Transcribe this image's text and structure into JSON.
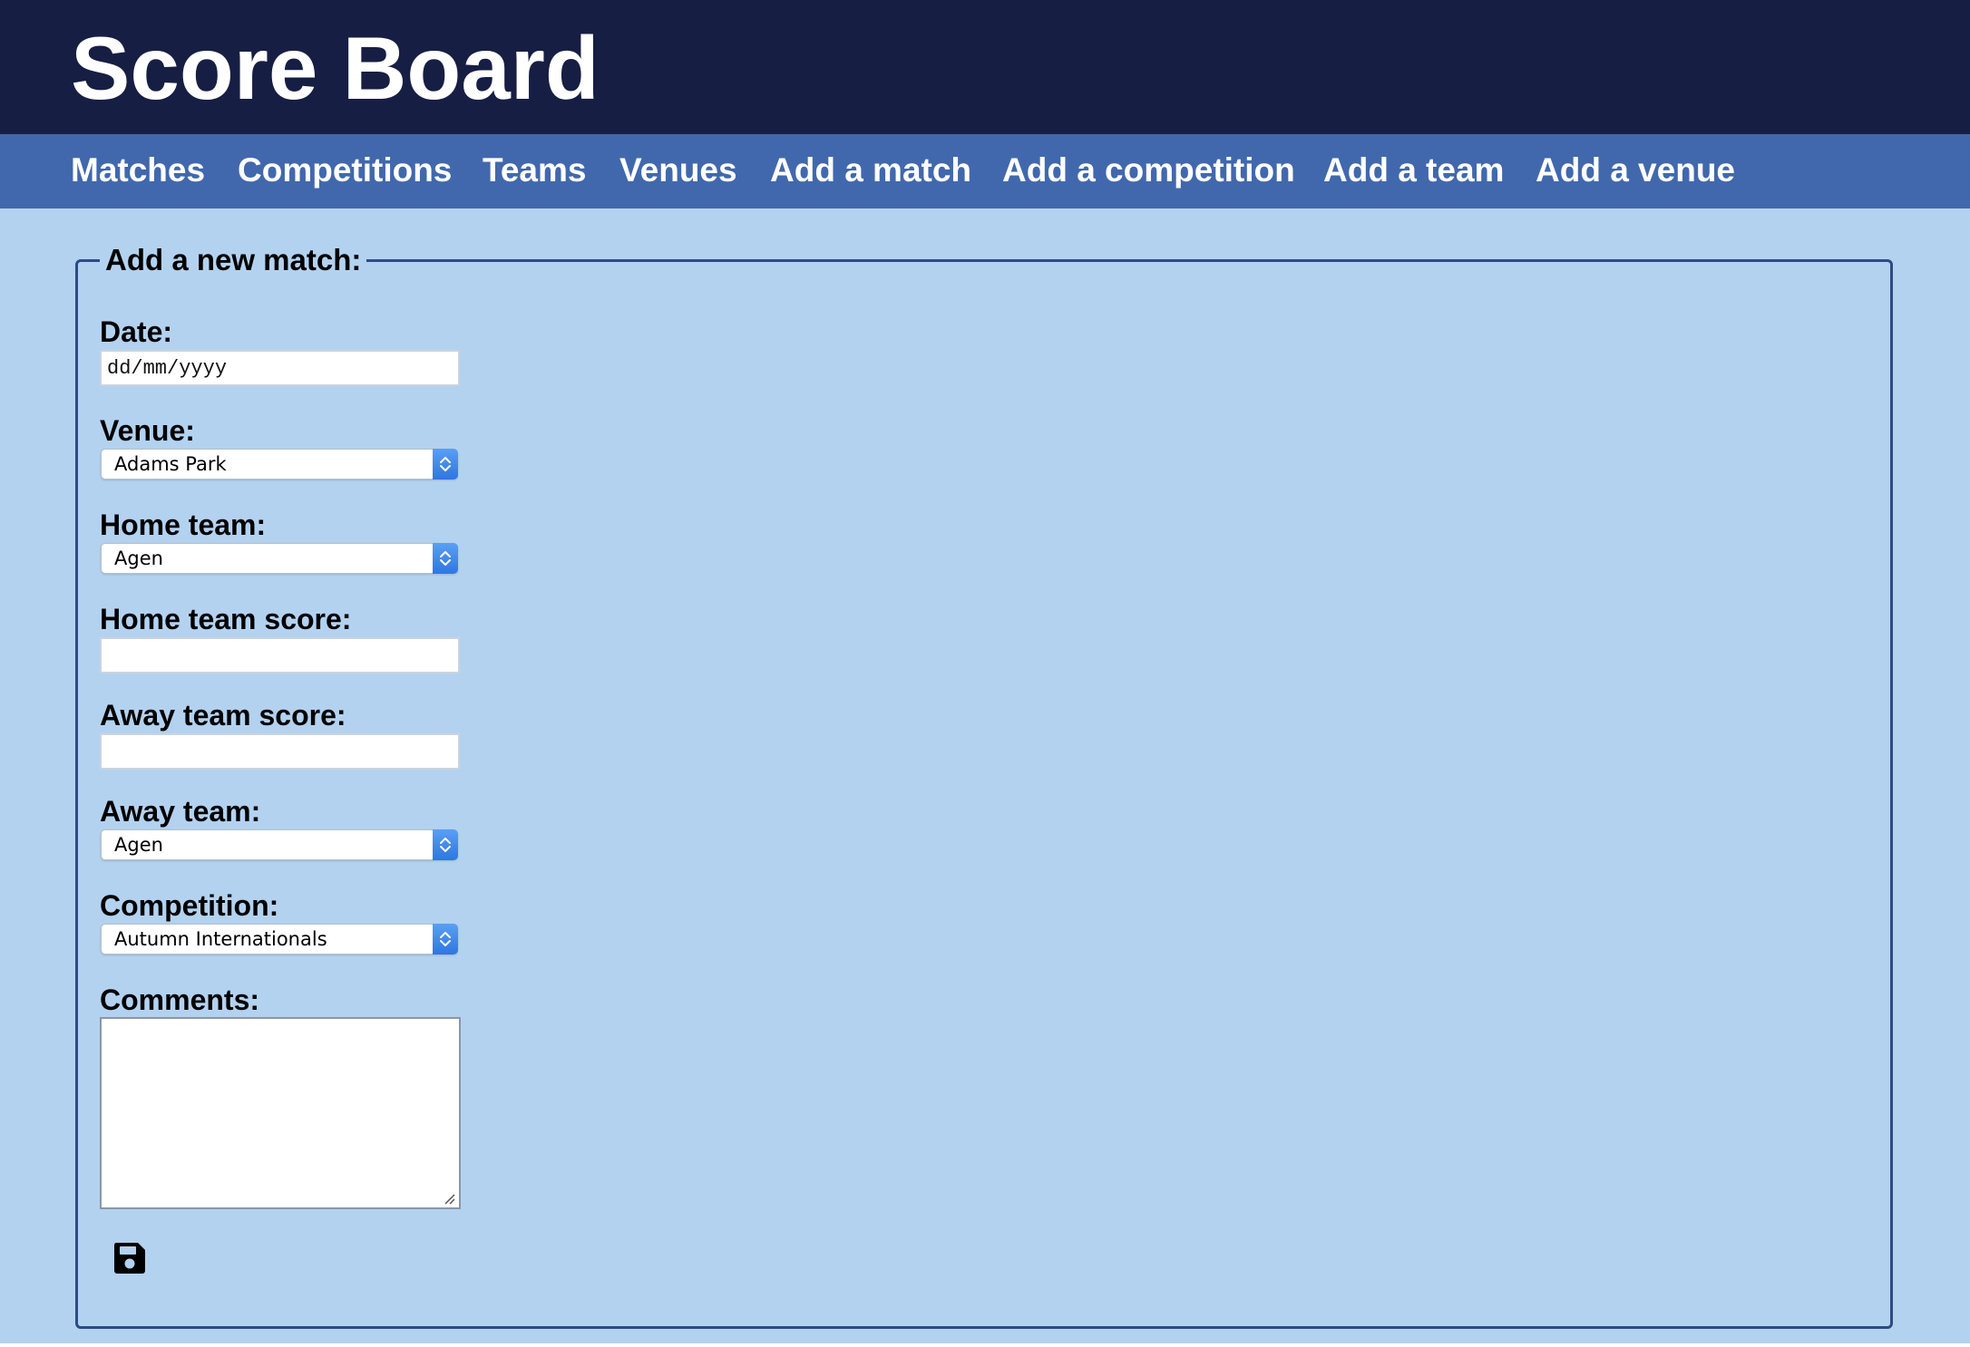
{
  "header": {
    "title": "Score Board"
  },
  "nav": {
    "items": [
      {
        "label": "Matches"
      },
      {
        "label": "Competitions"
      },
      {
        "label": "Teams"
      },
      {
        "label": "Venues"
      },
      {
        "label": "Add a match"
      },
      {
        "label": "Add a competition"
      },
      {
        "label": "Add a team"
      },
      {
        "label": "Add a venue"
      }
    ]
  },
  "form": {
    "legend": "Add a new match:",
    "date": {
      "label": "Date:",
      "placeholder": "dd/mm/yyyy",
      "value": ""
    },
    "venue": {
      "label": "Venue:",
      "selected": "Adams Park"
    },
    "home_team": {
      "label": "Home team:",
      "selected": "Agen"
    },
    "home_score": {
      "label": "Home team score:",
      "value": ""
    },
    "away_score": {
      "label": "Away team score:",
      "value": ""
    },
    "away_team": {
      "label": "Away team:",
      "selected": "Agen"
    },
    "competition": {
      "label": "Competition:",
      "selected": "Autumn Internationals"
    },
    "comments": {
      "label": "Comments:",
      "value": ""
    },
    "save_icon": "floppy-disk-icon"
  },
  "colors": {
    "header_bg": "#171e44",
    "nav_bg": "#4168ad",
    "page_bg": "#b3d2f0",
    "panel_border": "#2c4b85",
    "select_accent": "#3b82ec"
  }
}
